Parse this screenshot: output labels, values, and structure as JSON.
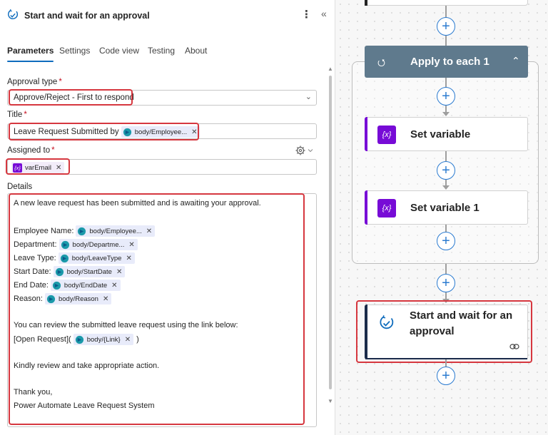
{
  "panel": {
    "title": "Start and wait for an approval",
    "more_label": "⋮",
    "collapse_label": "«",
    "tabs": [
      {
        "label": "Parameters",
        "active": true
      },
      {
        "label": "Settings",
        "active": false
      },
      {
        "label": "Code view",
        "active": false
      },
      {
        "label": "Testing",
        "active": false
      },
      {
        "label": "About",
        "active": false
      }
    ],
    "approval_type": {
      "label": "Approval type",
      "required_mark": "*",
      "value": "Approve/Reject - First to respond"
    },
    "title_field": {
      "label": "Title",
      "required_mark": "*",
      "prefix_text": "Leave Request Submitted by",
      "token": "body/Employee..."
    },
    "assigned_to": {
      "label": "Assigned to",
      "required_mark": "*",
      "token": "varEmail"
    },
    "details": {
      "label": "Details",
      "line1": "A new leave request has been submitted and is awaiting your approval.",
      "rows": [
        {
          "label": "Employee Name:",
          "token": "body/Employee..."
        },
        {
          "label": "Department:",
          "token": "body/Departme..."
        },
        {
          "label": "Leave Type:",
          "token": "body/LeaveType"
        },
        {
          "label": "Start Date:",
          "token": "body/StartDate"
        },
        {
          "label": "End Date:",
          "token": "body/EndDate"
        },
        {
          "label": "Reason:",
          "token": "body/Reason"
        }
      ],
      "review_text": "You can review the submitted leave request using the link below:",
      "link_prefix": "[Open Request](",
      "link_token": "body/{Link}",
      "link_suffix": ")",
      "kindly": "Kindly review and take appropriate action.",
      "thanks": "Thank you,",
      "signature": "Power Automate Leave Request System"
    },
    "token_close": "✕"
  },
  "canvas": {
    "foreach_title": "Apply to each 1",
    "set_variable_title": "Set variable",
    "set_variable_1_title": "Set variable 1",
    "variable_badge": "{x}",
    "approval_title": "Start and wait for an approval",
    "plus": "+"
  },
  "colors": {
    "accent_blue": "#0f6cbd",
    "highlight_red": "#d6373f",
    "variable_purple": "#770bd6",
    "foreach_header": "#5f7a8d",
    "token_bg": "#e8ebfa"
  },
  "icons": [
    "approval-icon",
    "more-icon",
    "collapse-icon",
    "chevron-down-icon",
    "gear-icon",
    "dataverse-icon",
    "variable-icon",
    "loop-icon",
    "caret-up-icon",
    "plus-icon",
    "link-icon"
  ]
}
